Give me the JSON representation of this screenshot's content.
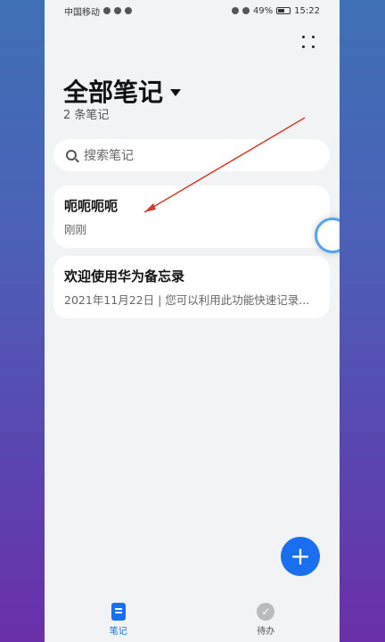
{
  "status": {
    "carrier": "中国移动",
    "battery": "49%",
    "time": "15:22"
  },
  "header": {
    "title": "全部笔记",
    "count": "2 条笔记"
  },
  "search": {
    "placeholder": "搜索笔记"
  },
  "notes": [
    {
      "title": "呃呃呃呃",
      "subtitle": "刚刚"
    },
    {
      "title": "欢迎使用华为备忘录",
      "subtitle": "2021年11月22日 | 您可以利用此功能快速记录..."
    }
  ],
  "fab": {
    "label": "+"
  },
  "nav": {
    "notes_label": "笔记",
    "todo_label": "待办",
    "todo_check": "✓"
  }
}
